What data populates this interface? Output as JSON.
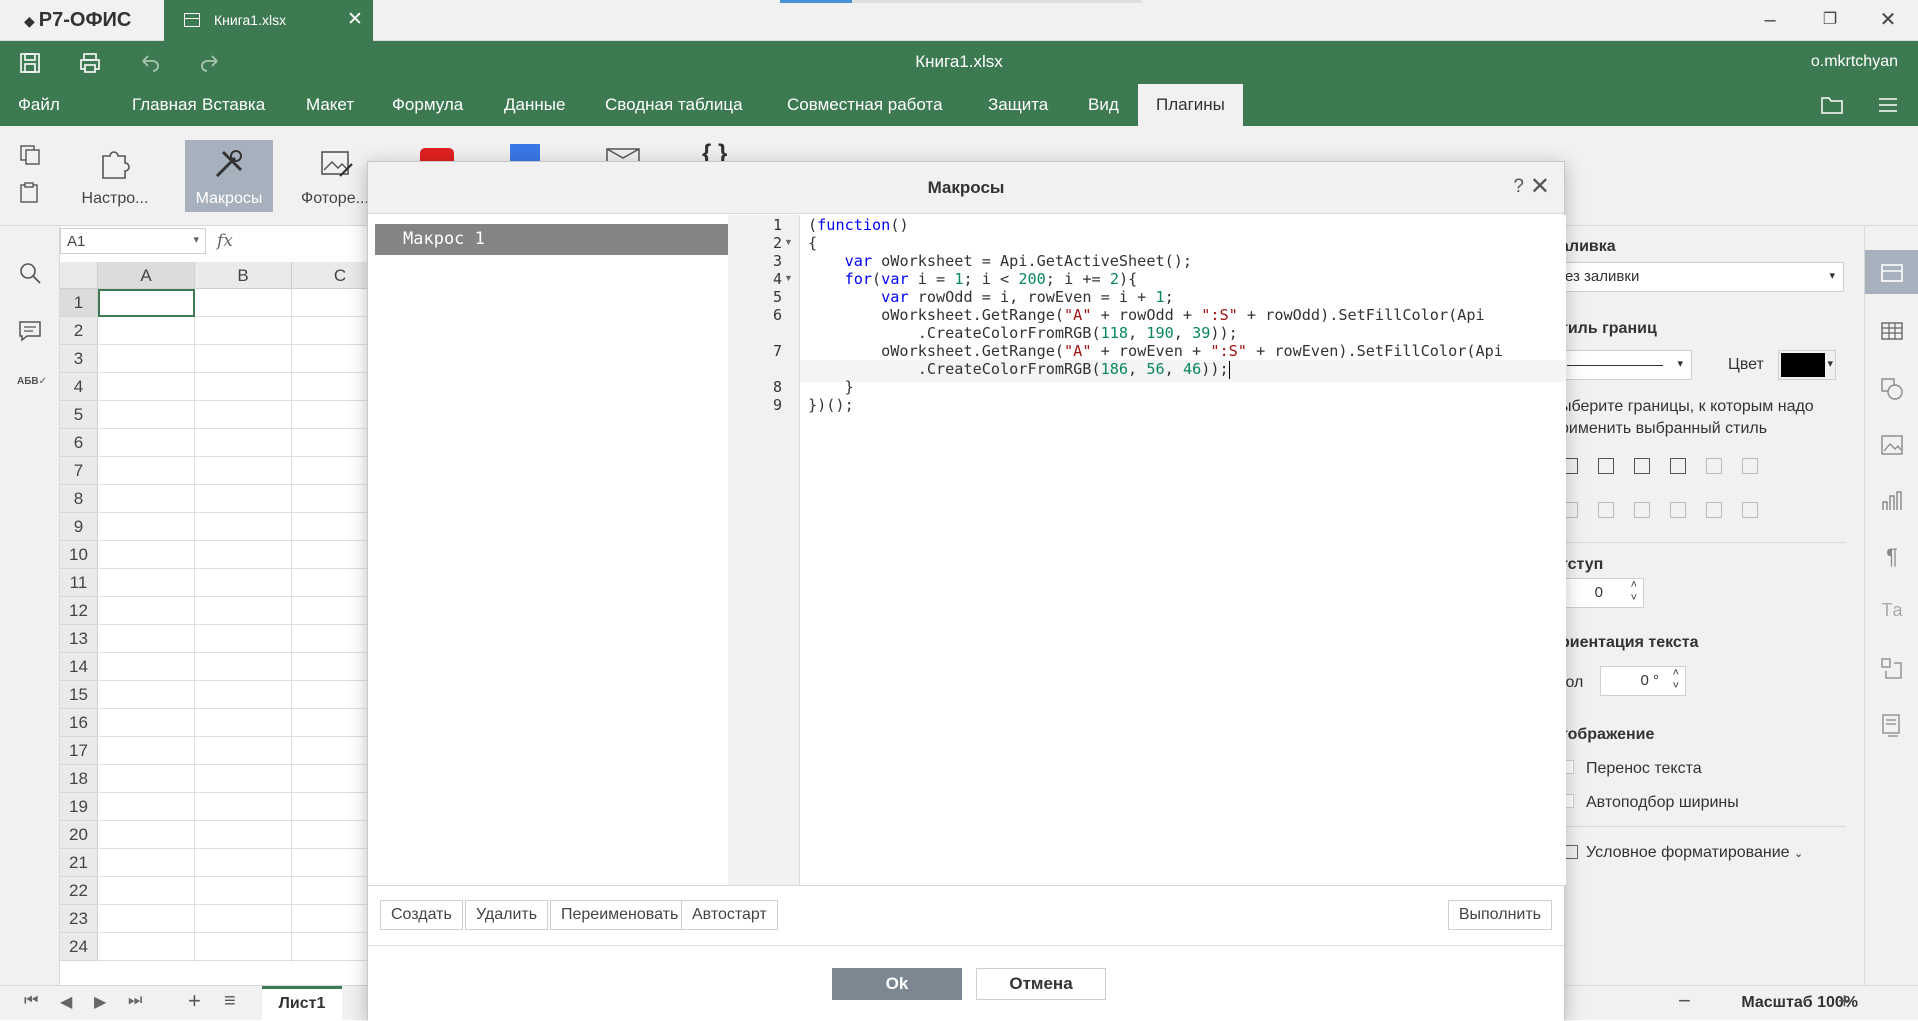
{
  "app": {
    "logo": "Р7-ОФИС",
    "doc_tab": "Книга1.xlsx",
    "title": "Книга1.xlsx",
    "user": "o.mkrtchyan"
  },
  "menu": [
    "Файл",
    "Главная",
    "Вставка",
    "Макет",
    "Формула",
    "Данные",
    "Сводная таблица",
    "Совместная работа",
    "Защита",
    "Вид",
    "Плагины"
  ],
  "ribbon": {
    "settings": "Настро...",
    "macros": "Макросы",
    "photo": "Фоторе..."
  },
  "formula": {
    "cell_ref": "A1",
    "fx": "fx"
  },
  "columns": [
    "A",
    "B",
    "C"
  ],
  "rows": [
    "1",
    "2",
    "3",
    "4",
    "5",
    "6",
    "7",
    "8",
    "9",
    "10",
    "11",
    "12",
    "13",
    "14",
    "15",
    "16",
    "17",
    "18",
    "19",
    "20",
    "21",
    "22",
    "23",
    "24"
  ],
  "sheet": {
    "tab": "Лист1",
    "zoom": "Масштаб 100%"
  },
  "right_panel": {
    "fill_title": "аливка",
    "fill_value": "ез заливки",
    "border_style_title": "тиль границ",
    "color_label": "Цвет",
    "border_hint_1": "ыберите границы, к которым надо",
    "border_hint_2": "рименить выбранный стиль",
    "indent_title": "тступ",
    "indent_value": "0",
    "orientation_title": "риентация текста",
    "angle_label": "гол",
    "angle_value": "0 °",
    "display_title": "тображение",
    "wrap_text": "Перенос текста",
    "autofit": "Автоподбор ширины",
    "cond_format": "Условное форматирование"
  },
  "dialog": {
    "title": "Макросы",
    "help": "?",
    "macros": [
      "Макрос 1"
    ],
    "line_numbers": [
      "1",
      "2",
      "3",
      "4",
      "5",
      "6",
      "",
      "7",
      "",
      "8",
      "9"
    ],
    "buttons": {
      "create": "Создать",
      "delete": "Удалить",
      "rename": "Переименовать",
      "autostart": "Автостарт",
      "run": "Выполнить",
      "ok": "Ok",
      "cancel": "Отмена"
    }
  },
  "colors": {
    "brand": "#3d7a52",
    "selected_macro": "#848484",
    "ok_button": "#7d8791"
  }
}
